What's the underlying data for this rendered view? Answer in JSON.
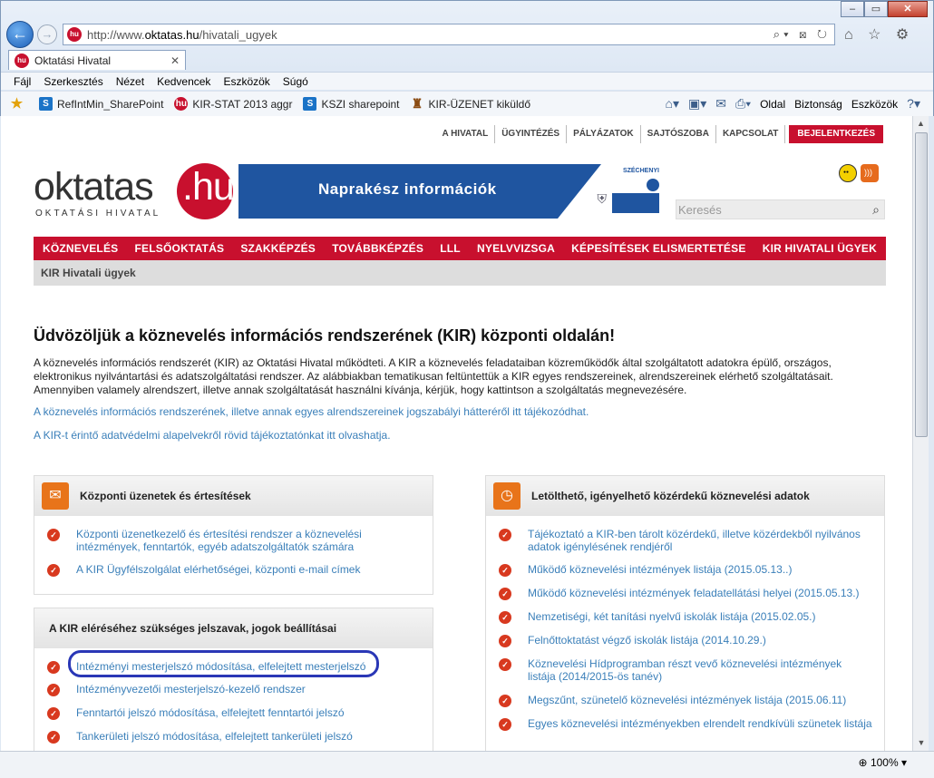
{
  "browser": {
    "url_prefix": "http://www.",
    "url_domain": "oktatas.hu",
    "url_path": "/hivatali_ugyek",
    "tab_title": "Oktatási Hivatal",
    "menu": [
      "Fájl",
      "Szerkesztés",
      "Nézet",
      "Kedvencek",
      "Eszközök",
      "Súgó"
    ],
    "favorites": [
      "RefIntMin_SharePoint",
      "KIR-STAT 2013 aggr",
      "KSZI sharepoint",
      "KIR-ÜZENET kiküldő"
    ],
    "commands": [
      "Oldal",
      "Biztonság",
      "Eszközök"
    ],
    "zoom": "100%"
  },
  "page": {
    "topnav": [
      "A HIVATAL",
      "ÜGYINTÉZÉS",
      "PÁLYÁZATOK",
      "SAJTÓSZOBA",
      "KAPCSOLAT"
    ],
    "login": "BEJELENTKEZÉS",
    "logo_main": "oktatas",
    "logo_hu": ".hu",
    "logo_sub": "OKTATÁSI HIVATAL",
    "banner_text": "Naprakész információk",
    "banner_brand": "SZÉCHENYI",
    "search_placeholder": "Keresés",
    "mainnav": [
      "KÖZNEVELÉS",
      "FELSŐOKTATÁS",
      "SZAKKÉPZÉS",
      "TOVÁBBKÉPZÉS",
      "LLL",
      "NYELVVIZSGA",
      "KÉPESÍTÉSEK ELISMERTETÉSE",
      "KIR HIVATALI ÜGYEK"
    ],
    "breadcrumb": "KIR Hivatali ügyek",
    "welcome": "Üdvözöljük a köznevelés információs rendszerének (KIR) központi oldalán!",
    "intro": "A köznevelés információs rendszerét (KIR) az Oktatási Hivatal működteti. A KIR a köznevelés feladataiban közreműködők által szolgáltatott adatokra épülő, országos, elektronikus nyilvántartási és adatszolgáltatási rendszer. Az alábbiakban tematikusan feltüntettük a KIR egyes rendszereinek, alrendszereinek elérhető szolgáltatásait. Amennyiben valamely alrendszert, illetve annak szolgáltatását használni kívánja, kérjük, hogy kattintson a szolgáltatás megnevezésére.",
    "link_legal": "A köznevelés információs rendszerének, illetve annak egyes alrendszereinek jogszabályi hátteréről itt tájékozódhat.",
    "link_privacy": "A KIR-t érintő adatvédelmi alapelvekről rövid tájékoztatónkat itt olvashatja.",
    "box1": {
      "title": "Központi üzenetek és értesítések",
      "items": [
        "Központi üzenetkezelő és értesítési rendszer a köznevelési intézmények, fenntartók, egyéb adatszolgáltatók számára",
        "A KIR Ügyfélszolgálat elérhetőségei, központi e-mail címek"
      ]
    },
    "box2": {
      "title": "A KIR eléréséhez szükséges jelszavak, jogok beállításai",
      "items": [
        "Intézményi mesterjelszó módosítása, elfelejtett mesterjelszó",
        "Intézményvezetői mesterjelszó-kezelő rendszer",
        "Fenntartói jelszó módosítása, elfelejtett fenntartói jelszó",
        "Tankerületi jelszó módosítása, elfelejtett tankerületi jelszó"
      ]
    },
    "box3": {
      "title": "Letölthető, igényelhető közérdekű köznevelési adatok",
      "items": [
        "Tájékoztató a KIR-ben tárolt közérdekű, illetve közérdekből nyilvános adatok igénylésének rendjéről",
        "Működő köznevelési intézmények listája (2015.05.13..)",
        "Működő köznevelési intézmények feladatellátási helyei (2015.05.13.)",
        "Nemzetiségi, két tanítási nyelvű iskolák listája (2015.02.05.)",
        "Felnőttoktatást végző iskolák listája (2014.10.29.)",
        "Köznevelési Hídprogramban részt vevő köznevelési intézmények listája (2014/2015-ös tanév)",
        "Megszűnt, szünetelő köznevelési intézmények listája (2015.06.11)",
        "Egyes köznevelési intézményekben elrendelt rendkívüli szünetek listája"
      ]
    }
  }
}
